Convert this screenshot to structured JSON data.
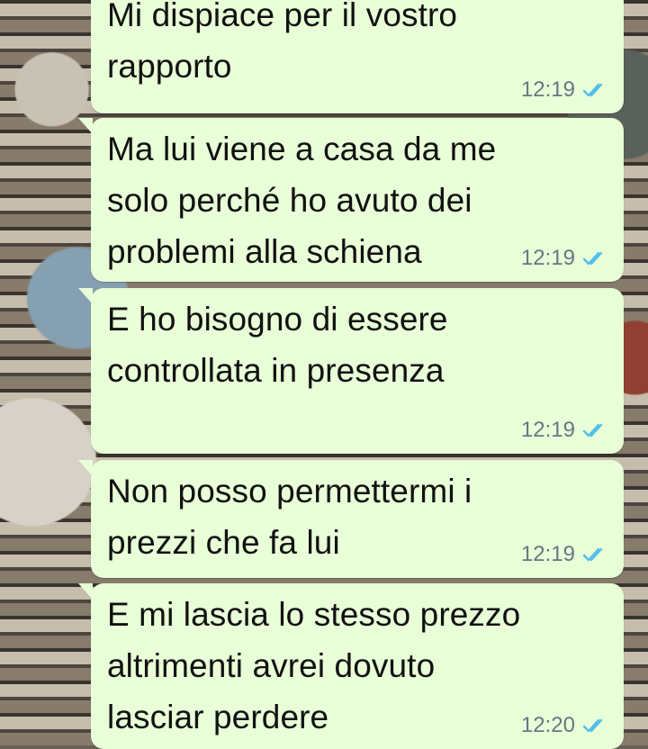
{
  "messages": [
    {
      "text": "Mi dispiace per il vostro rapporto",
      "time": "12:19",
      "status": "read"
    },
    {
      "text": "Ma lui viene a casa da me solo perché ho avuto dei problemi alla schiena",
      "time": "12:19",
      "status": "read"
    },
    {
      "text": "E ho bisogno di essere controllata in presenza",
      "time": "12:19",
      "status": "read"
    },
    {
      "text": "Non posso permettermi i prezzi che fa lui",
      "time": "12:19",
      "status": "read"
    },
    {
      "text": "E mi lascia lo stesso prezzo altrimenti avrei dovuto lasciar perdere",
      "time": "12:20",
      "status": "read"
    }
  ],
  "colors": {
    "bubble": "#e8ffd8",
    "text": "#111111",
    "time": "#667781",
    "tick": "#53bdeb"
  }
}
